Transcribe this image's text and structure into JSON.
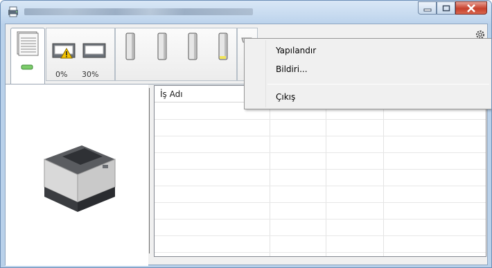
{
  "window": {
    "title": "",
    "icon": "printer-app-icon",
    "buttons": {
      "minimize": "minimize-icon",
      "maximize": "maximize-icon",
      "close": "close-icon"
    }
  },
  "toolbar": {
    "tabs": [
      {
        "name": "jobs-tab",
        "icon": "document-stack-icon"
      },
      {
        "name": "toner-tab",
        "icon": "tray-icon"
      },
      {
        "name": "ink-tab",
        "icon": "cartridge-icon"
      }
    ],
    "tray_levels": [
      "0%",
      "30%"
    ],
    "settings_icon": "gear-icon"
  },
  "job_list": {
    "columns": [
      "İş Adı",
      "",
      "",
      ""
    ]
  },
  "context_menu": {
    "items": [
      "Yapılandır",
      "Bildiri...",
      "Çıkış"
    ]
  },
  "colors": {
    "title_bar": "#bcd3ec",
    "close_button": "#c6402c",
    "warning": "#f5c400"
  }
}
